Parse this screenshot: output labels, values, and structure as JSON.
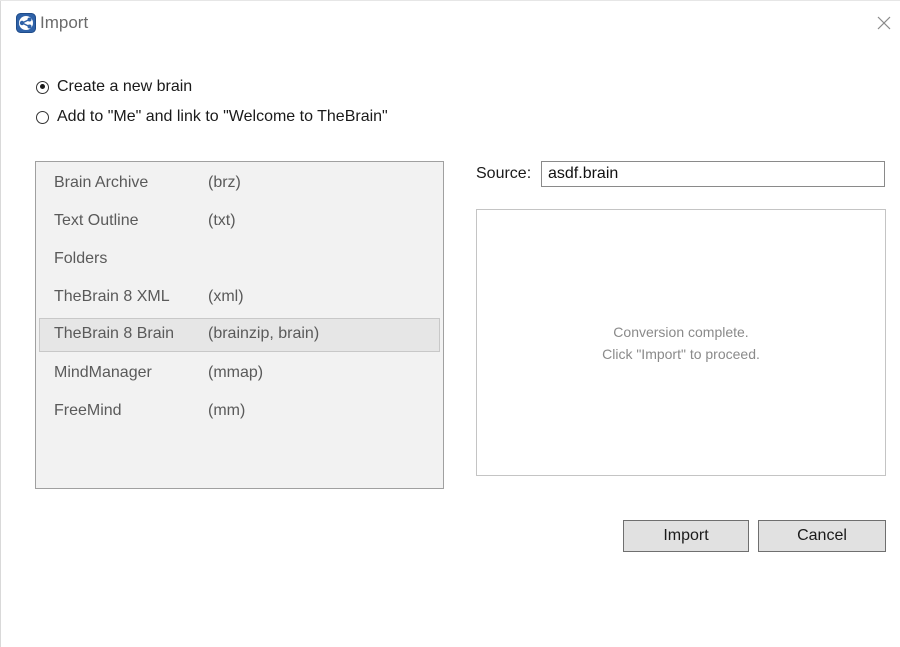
{
  "window": {
    "title": "Import"
  },
  "options": {
    "items": [
      {
        "label": "Create a new brain",
        "checked": true
      },
      {
        "label": "Add to \"Me\" and link to \"Welcome to TheBrain\"",
        "checked": false
      }
    ]
  },
  "formats": {
    "items": [
      {
        "name": "Brain Archive",
        "ext": "(brz)"
      },
      {
        "name": "Text Outline",
        "ext": "(txt)"
      },
      {
        "name": "Folders",
        "ext": ""
      },
      {
        "name": "TheBrain 8 XML",
        "ext": "(xml)"
      },
      {
        "name": "TheBrain 8 Brain",
        "ext": "(brainzip, brain)"
      },
      {
        "name": "MindManager",
        "ext": "(mmap)"
      },
      {
        "name": "FreeMind",
        "ext": "(mm)"
      }
    ],
    "selected": "TheBrain 8 Brain"
  },
  "source": {
    "label": "Source:",
    "value": "asdf.brain"
  },
  "status": {
    "line1": "Conversion complete.",
    "line2": "Click \"Import\" to proceed."
  },
  "buttons": {
    "import": "Import",
    "cancel": "Cancel"
  },
  "colors": {
    "icon_blue": "#3a6fb0",
    "list_bg": "#f2f2f2",
    "button_bg": "#e1e1e1"
  }
}
